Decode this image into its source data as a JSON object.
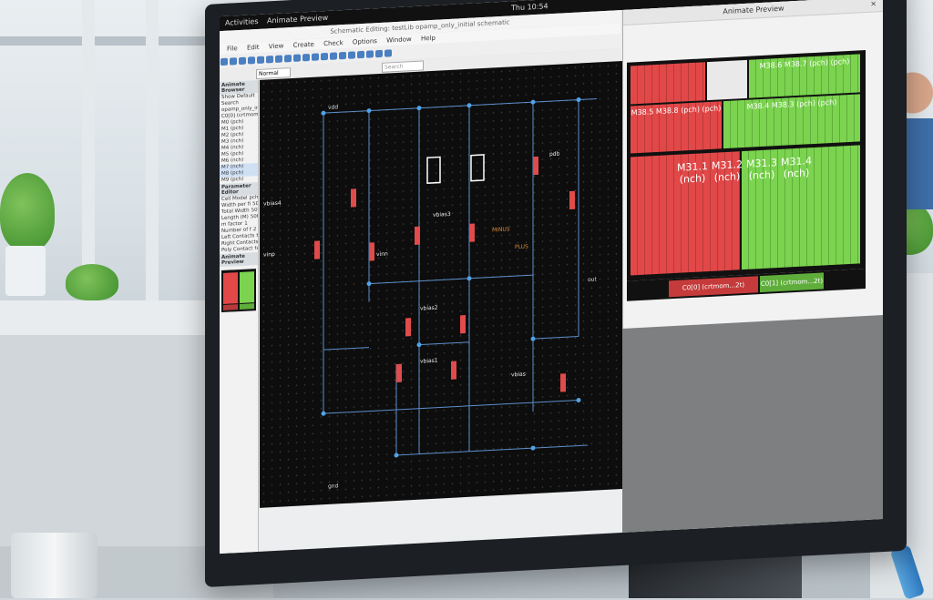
{
  "desktop": {
    "activities": "Activities",
    "app_menu": "Animate Preview",
    "clock": "Thu 10:54"
  },
  "schematic_window": {
    "title": "Schematic Editing: testLib opamp_only_initial schematic",
    "menu": [
      "File",
      "Edit",
      "View",
      "Create",
      "Check",
      "Options",
      "Window",
      "Help"
    ],
    "mode": "Normal",
    "search_placeholder": "Search"
  },
  "left_panel": {
    "browser_title": "Animate Browser",
    "show_label": "Show",
    "show_value": "Default",
    "search_label": "Search",
    "tree_items": [
      "opamp_only_initial",
      "C0[0] (crtmom...)",
      "M0 (pch)",
      "M1 (pch)",
      "M2 (pch)",
      "M3 (nch)",
      "M4 (nch)",
      "M5 (pch)",
      "M6 (nch)",
      "M7 (nch)",
      "M8 (pch)",
      "M9 (pch)"
    ],
    "param_title": "Parameter Editor",
    "params": [
      {
        "name": "Cell Model",
        "value": "pch"
      },
      {
        "name": "Width per fi",
        "value": "50u"
      },
      {
        "name": "Total Width",
        "value": "50u"
      },
      {
        "name": "Length (M)",
        "value": "500.0n"
      },
      {
        "name": "m factor",
        "value": "1"
      },
      {
        "name": "Number of f",
        "value": "2"
      },
      {
        "name": "Left Contacts",
        "value": "true"
      },
      {
        "name": "Right Contacts",
        "value": "true"
      },
      {
        "name": "Poly Contact",
        "value": "false"
      }
    ],
    "preview_title": "Animate Preview"
  },
  "canvas": {
    "labels": [
      "vbias4",
      "vbias3",
      "vbias2",
      "vbias1",
      "vbias",
      "vinp",
      "vinn",
      "pdb",
      "MINUS",
      "PLUS",
      "out",
      "vdd",
      "gnd"
    ]
  },
  "animate_preview": {
    "title": "Animate Preview",
    "close": "×",
    "cells_top": [
      "M38.6 M38.7 (pch) (pch)",
      "M38.5 M38.8 (pch) (pch)",
      "M38.4 M38.3 (pch) (pch)"
    ],
    "cells_mid": [
      "M31.1 (nch)",
      "M31.2 (nch)",
      "M31.3 (nch)",
      "M31.4 (nch)"
    ],
    "legend": [
      "C0[0] (crtmom...2t)",
      "C0[1] (crtmom...2t)"
    ],
    "colors": {
      "red": "#e24848",
      "green": "#7bd34f",
      "grey": "#bdbdbd"
    }
  }
}
